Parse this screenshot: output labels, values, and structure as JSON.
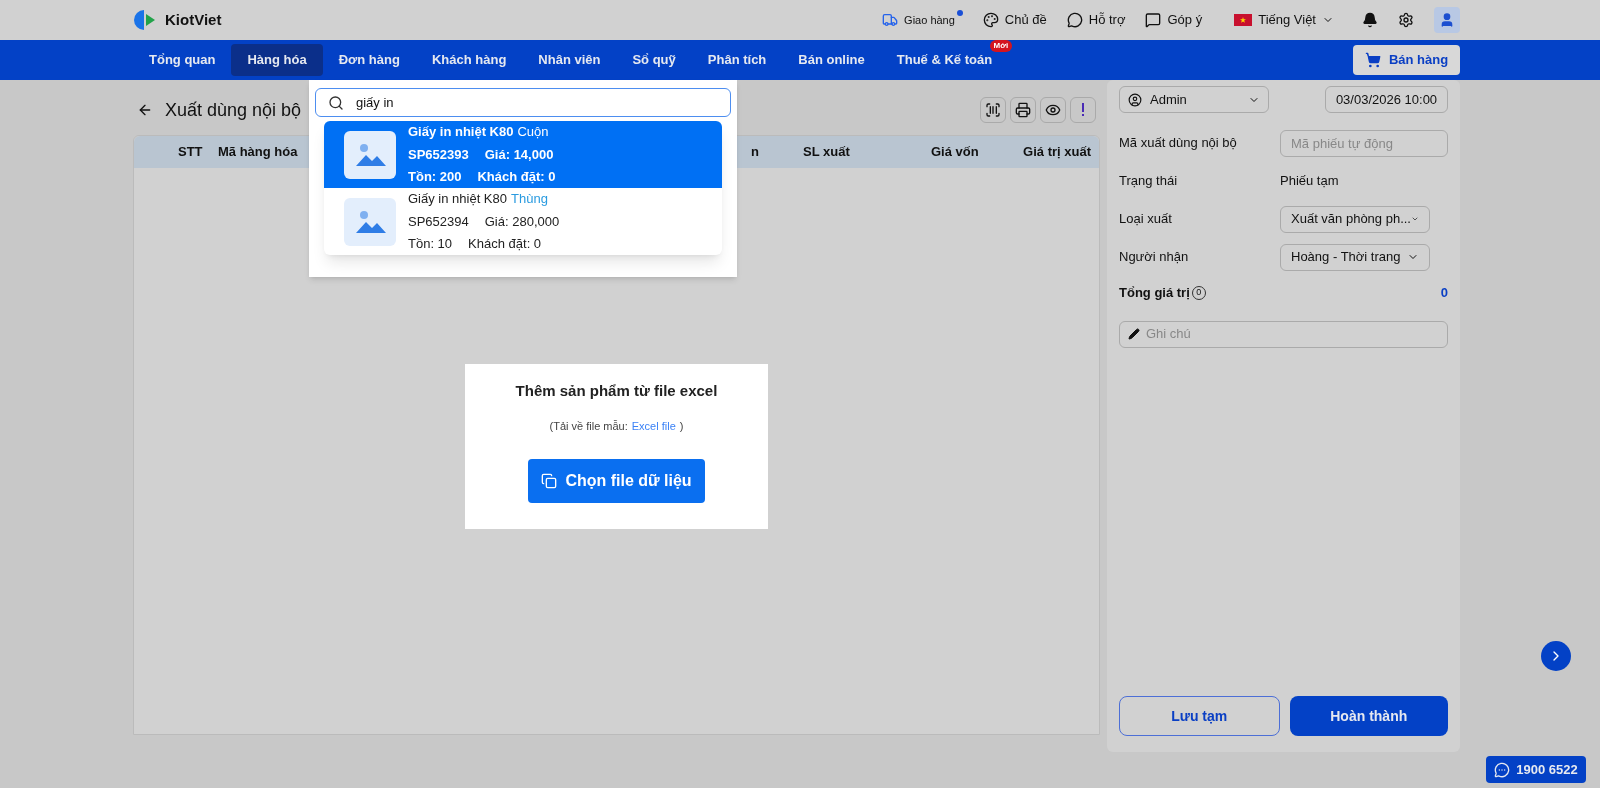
{
  "app": {
    "logo_text": "KiotViet"
  },
  "topbar": {
    "items": [
      {
        "kind": "delivery",
        "label": "Giao hàng",
        "dot": true
      },
      {
        "kind": "theme",
        "label": "Chủ đề",
        "dot": false
      },
      {
        "kind": "help",
        "label": "Hỗ trợ",
        "dot": false
      },
      {
        "kind": "feedback",
        "label": "Góp ý",
        "dot": false
      }
    ],
    "language": "Tiếng Việt"
  },
  "nav": {
    "items": [
      {
        "label": "Tổng quan",
        "selected": false
      },
      {
        "label": "Hàng hóa",
        "selected": true
      },
      {
        "label": "Đơn hàng",
        "selected": false
      },
      {
        "label": "Khách hàng",
        "selected": false
      },
      {
        "label": "Nhân viên",
        "selected": false
      },
      {
        "label": "Sổ quỹ",
        "selected": false
      },
      {
        "label": "Phân tích",
        "selected": false
      },
      {
        "label": "Bán online",
        "selected": false
      },
      {
        "label": "Thuế & Kế toán",
        "selected": false,
        "badge": "Mới"
      }
    ],
    "sell_button": "Bán hàng"
  },
  "page": {
    "title": "Xuất dùng nội bộ"
  },
  "search": {
    "value": "giấy in",
    "results": [
      {
        "name": "Giấy in nhiệt K80",
        "unit": "Cuộn",
        "code": "SP652393",
        "price": "Giá: 14,000",
        "stock": "Tồn: 200",
        "ordered": "Khách đặt: 0",
        "selected": true
      },
      {
        "name": "Giấy in nhiệt K80",
        "unit": "Thùng",
        "code": "SP652394",
        "price": "Giá: 280,000",
        "stock": "Tồn: 10",
        "ordered": "Khách đặt: 0",
        "selected": false
      }
    ]
  },
  "table": {
    "columns": [
      "STT",
      "Mã hàng hóa",
      "n",
      "SL xuất",
      "Giá vốn",
      "Giá trị xuất"
    ]
  },
  "import": {
    "title": "Thêm sản phẩm từ file excel",
    "hint_prefix": "(Tải về file mẫu:",
    "hint_link": "Excel file",
    "hint_suffix": ")",
    "button": "Chọn file dữ liệu"
  },
  "side": {
    "user": "Admin",
    "date": "03/03/2026 10:00",
    "fields": [
      {
        "kind": "input",
        "label": "Mã xuất dùng nội bộ",
        "placeholder": "Mã phiếu tự động"
      },
      {
        "kind": "text",
        "label": "Trạng thái",
        "value": "Phiếu tạm"
      },
      {
        "kind": "select",
        "label": "Loại xuất",
        "value": "Xuất văn phòng ph..."
      },
      {
        "kind": "select",
        "label": "Người nhận",
        "value": "Hoàng - Thời trang"
      }
    ],
    "total_label": "Tổng giá trị",
    "total_count": "0",
    "total_value": "0",
    "note_placeholder": "Ghi chú",
    "save": "Lưu tạm",
    "finish": "Hoàn thành"
  },
  "hotline": "1900 6522"
}
